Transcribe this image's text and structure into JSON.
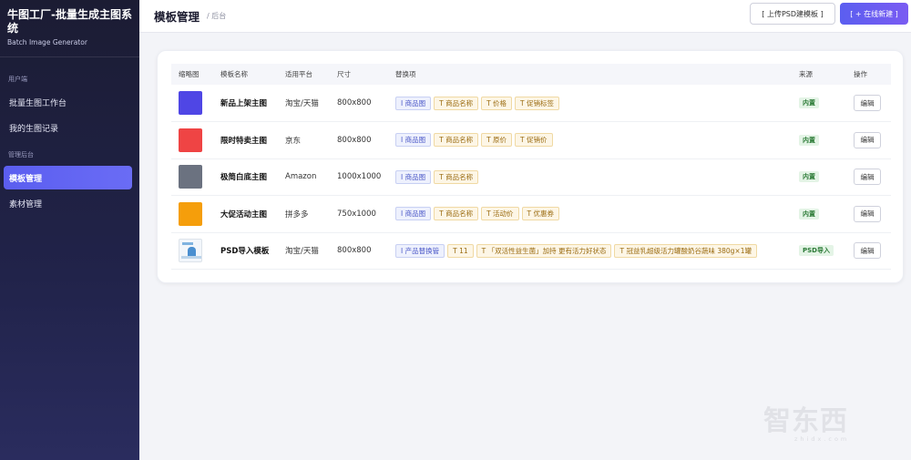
{
  "app": {
    "title": "牛图工厂-批量生成主图系统",
    "subtitle": "Batch Image Generator"
  },
  "sidebar": {
    "section_user": "用户端",
    "section_admin": "管理后台",
    "items": [
      {
        "label": "批量生图工作台",
        "active": false
      },
      {
        "label": "我的生图记录",
        "active": false
      },
      {
        "label": "模板管理",
        "active": true
      },
      {
        "label": "素材管理",
        "active": false
      }
    ]
  },
  "header": {
    "title": "模板管理",
    "breadcrumb": "/ 后台",
    "upload_psd": "[ 上传PSD建模板 ]",
    "create_online": "[ + 在线新建 ]"
  },
  "table": {
    "columns": [
      "缩略图",
      "模板名称",
      "适用平台",
      "尺寸",
      "替换项",
      "来源",
      "操作"
    ],
    "rows": [
      {
        "thumb_color": "#4f46e5",
        "name": "新品上架主图",
        "platform": "淘宝/天猫",
        "size": "800x800",
        "tags": [
          {
            "type": "img",
            "label": "I 商品图"
          },
          {
            "type": "txt",
            "label": "T 商品名称"
          },
          {
            "type": "txt",
            "label": "T 价格"
          },
          {
            "type": "txt",
            "label": "T 促销标签"
          }
        ],
        "source": "内置",
        "action": "编辑"
      },
      {
        "thumb_color": "#ef4444",
        "name": "限时特卖主图",
        "platform": "京东",
        "size": "800x800",
        "tags": [
          {
            "type": "img",
            "label": "I 商品图"
          },
          {
            "type": "txt",
            "label": "T 商品名称"
          },
          {
            "type": "txt",
            "label": "T 原价"
          },
          {
            "type": "txt",
            "label": "T 促销价"
          }
        ],
        "source": "内置",
        "action": "编辑"
      },
      {
        "thumb_color": "#6b7280",
        "name": "极简白底主图",
        "platform": "Amazon",
        "size": "1000x1000",
        "tags": [
          {
            "type": "img",
            "label": "I 商品图"
          },
          {
            "type": "txt",
            "label": "T 商品名称"
          }
        ],
        "source": "内置",
        "action": "编辑"
      },
      {
        "thumb_color": "#f59e0b",
        "name": "大促活动主图",
        "platform": "拼多多",
        "size": "750x1000",
        "tags": [
          {
            "type": "img",
            "label": "I 商品图"
          },
          {
            "type": "txt",
            "label": "T 商品名称"
          },
          {
            "type": "txt",
            "label": "T 活动价"
          },
          {
            "type": "txt",
            "label": "T 优惠券"
          }
        ],
        "source": "内置",
        "action": "编辑"
      },
      {
        "thumb_color": "psd-image",
        "name": "PSD导入模板",
        "platform": "淘宝/天猫",
        "size": "800x800",
        "tags": [
          {
            "type": "img",
            "label": "I 产品替换管"
          },
          {
            "type": "txt",
            "label": "T 11"
          },
          {
            "type": "txt",
            "label": "T 「双活性益生菌」加持 更有活力好状态"
          },
          {
            "type": "txt",
            "label": "T 冠益乳超级活力罐酸奶谷蔬味 380g×1罐"
          }
        ],
        "source": "PSD导入",
        "action": "编辑"
      }
    ]
  },
  "colors": {
    "accent": "#5b5ef0",
    "sidebar_bg": "#1b1c33",
    "badge_green": "#2b7a36"
  },
  "watermark": {
    "text": "智东西",
    "sub": "zhidx.com"
  }
}
